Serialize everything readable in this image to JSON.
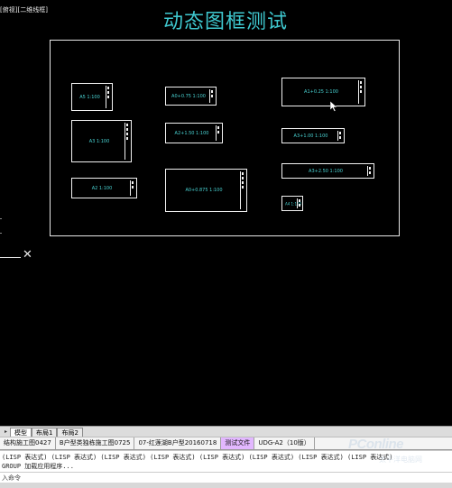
{
  "viewport": {
    "label": "[俯视][二维线框]",
    "title": "动态图框测试",
    "title_color": "#3fc9d0",
    "frame_label_color": "#49d3d3",
    "background": "#000000"
  },
  "title_blocks": [
    {
      "label": "A5 1:100"
    },
    {
      "label": "A0+0.75 1:100"
    },
    {
      "label": "A1+0.25 1:100"
    },
    {
      "label": "A3 1:100"
    },
    {
      "label": "A2+1.50 1:100"
    },
    {
      "label": "A3+1.00 1:100"
    },
    {
      "label": "A2 1:100"
    },
    {
      "label": "A3+2.50 1:100"
    },
    {
      "label": "A0+0.875 1:100"
    },
    {
      "label": "A4 1:100"
    }
  ],
  "ucs_icon": "ucs-x-axis-icon",
  "layout_tabs": {
    "arrow": "▸",
    "items": [
      {
        "label": "模型",
        "active": true
      },
      {
        "label": "布局1",
        "active": false
      },
      {
        "label": "布局2",
        "active": false
      }
    ]
  },
  "doc_tabs": [
    {
      "label": "结构施工图0427",
      "active": false
    },
    {
      "label": "B户型类独栋施工图0725",
      "active": false
    },
    {
      "label": "07-红莲湖B户型20160718",
      "active": false
    },
    {
      "label": "测试文件",
      "active": true
    },
    {
      "label": "UDG-A2（10版）",
      "active": false
    }
  ],
  "command": {
    "line1": "(LISP 表达式) (LISP 表达式) (LISP 表达式) (LISP 表达式) (LISP 表达式) (LISP 表达式) (LISP 表达式) (LISP 表达式)",
    "line2": "GROUP 加载应用程序...",
    "prompt": "入命令"
  },
  "watermark": {
    "text": "PConline",
    "sub": "太平洋电脑网"
  }
}
